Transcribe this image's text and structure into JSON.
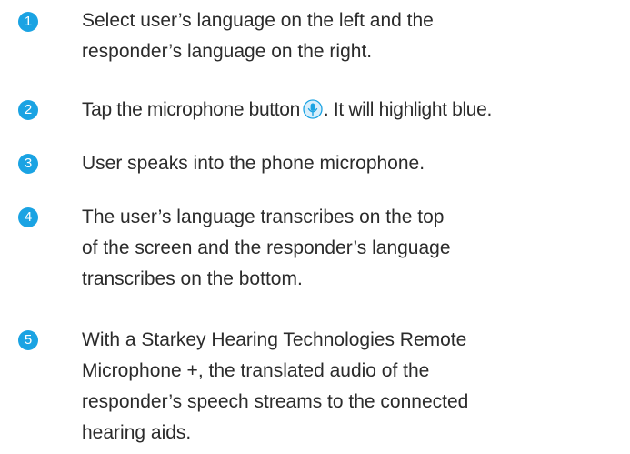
{
  "accent_color": "#1aa3e3",
  "icons": {
    "step_badge": "numbered-circle",
    "inline_microphone": "microphone-button-icon"
  },
  "steps": [
    {
      "number": "1",
      "lines": [
        "Select user’s language on the left and the",
        "responder’s language on the right."
      ]
    },
    {
      "number": "2",
      "before_icon": "Tap the microphone button",
      "after_icon": ". It will highlight blue."
    },
    {
      "number": "3",
      "lines": [
        "User speaks into the phone microphone."
      ]
    },
    {
      "number": "4",
      "lines": [
        "The user’s language transcribes on the top",
        "of the screen and the responder’s language",
        "transcribes on the bottom."
      ]
    },
    {
      "number": "5",
      "lines": [
        "With a Starkey Hearing Technologies Remote",
        "Microphone +, the translated audio of the",
        "responder’s speech streams to the connected",
        "hearing aids."
      ]
    }
  ]
}
